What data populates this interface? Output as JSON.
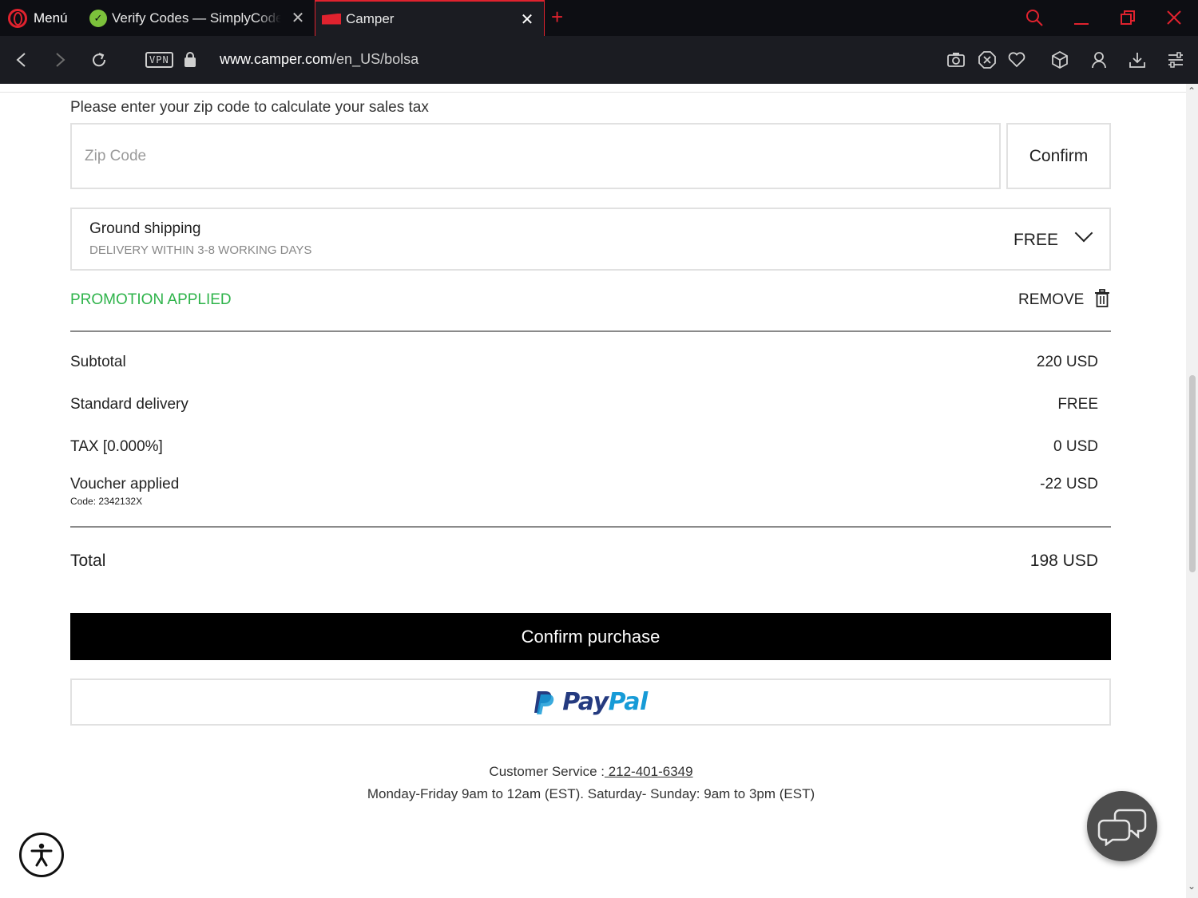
{
  "browser": {
    "menu_label": "Menú",
    "tabs": [
      {
        "title": "Verify Codes — SimplyCodes",
        "icon": "simplycodes-favicon"
      },
      {
        "title": "Camper",
        "icon": "camper-favicon"
      }
    ],
    "url_host": "www.camper.com",
    "url_path": "/en_US/bolsa",
    "vpn_label": "VPN"
  },
  "checkout": {
    "zip_prompt": "Please enter your zip code to calculate your sales tax",
    "zip_placeholder": "Zip Code",
    "confirm_label": "Confirm",
    "shipping": {
      "title": "Ground shipping",
      "subtitle": "DELIVERY WITHIN 3-8 WORKING DAYS",
      "price": "FREE"
    },
    "promotion_label": "PROMOTION APPLIED",
    "remove_label": "REMOVE",
    "summary": {
      "subtotal_label": "Subtotal",
      "subtotal_value": "220 USD",
      "delivery_label": "Standard delivery",
      "delivery_value": "FREE",
      "tax_label": "TAX [0.000%]",
      "tax_value": "0 USD",
      "voucher_label": "Voucher applied",
      "voucher_code": "Code: 2342132X",
      "voucher_value": "-22 USD",
      "total_label": "Total",
      "total_value": "198 USD"
    },
    "purchase_label": "Confirm purchase",
    "paypal": {
      "word_part1": "Pay",
      "word_part2": "Pal"
    }
  },
  "footer": {
    "customer_service_label": "Customer Service :",
    "phone": " 212-401-6349",
    "hours": "Monday-Friday 9am to 12am (EST). Saturday- Sunday: 9am to 3pm (EST)"
  },
  "colors": {
    "promo_green": "#2eb34a",
    "opera_red": "#e0222e",
    "paypal_dark": "#253b80",
    "paypal_light": "#179bd7"
  }
}
